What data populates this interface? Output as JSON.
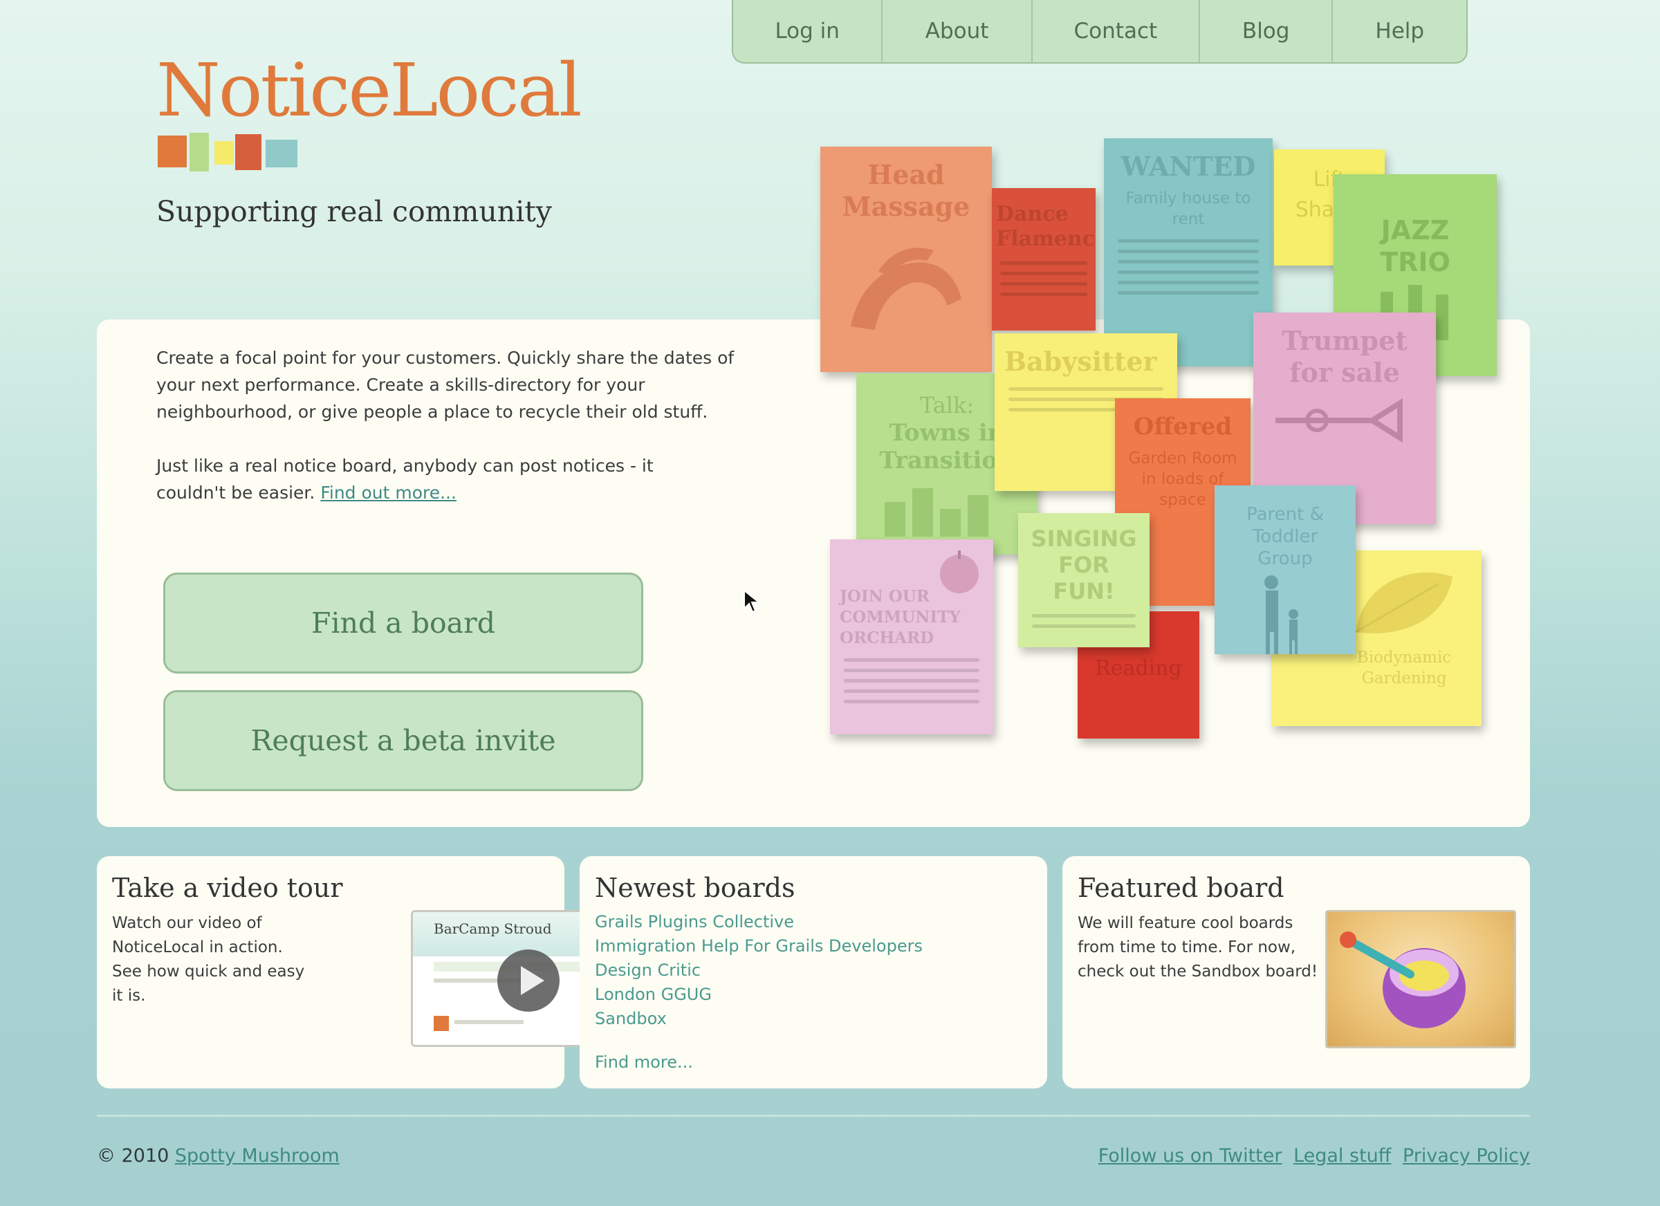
{
  "nav": {
    "items": [
      {
        "label": "Log in"
      },
      {
        "label": "About"
      },
      {
        "label": "Contact"
      },
      {
        "label": "Blog"
      },
      {
        "label": "Help"
      }
    ]
  },
  "brand": {
    "name": "NoticeLocal",
    "tagline": "Supporting real community",
    "colors": [
      "#e0793b",
      "#b6dc8a",
      "#f5ea6a",
      "#d65f3e",
      "#8fc9c8"
    ]
  },
  "hero": {
    "paragraph1": "Create a focal point for your customers. Quickly share the dates of your next performance. Create a skills-directory for your neighbourhood, or give people a place to recycle their old stuff.",
    "paragraph2": "Just like a real notice board, anybody can post notices - it couldn't be easier.",
    "find_out_more": "Find out more...",
    "find_board_button": "Find a board",
    "beta_invite_button": "Request a beta invite"
  },
  "notes": {
    "head_massage": {
      "line1": "Head",
      "line2": "Massage"
    },
    "dance": {
      "line1": "Dance",
      "line2": "Flamenco"
    },
    "wanted": {
      "title": "WANTED",
      "subtitle": "Family house to rent"
    },
    "lift_share": {
      "line1": "Lift",
      "line2": "Share!"
    },
    "jazz_trio": {
      "line1": "JAZZ",
      "line2": "TRIO"
    },
    "towns": {
      "line1": "Talk:",
      "line2": "Towns in",
      "line3": "Transition"
    },
    "babysitter": {
      "title": "Babysitter"
    },
    "offered": {
      "title": "Offered",
      "subtitle": "Garden Room in loads of space"
    },
    "trumpet": {
      "line1": "Trumpet",
      "line2": "for sale"
    },
    "parent_toddler": {
      "title": "Parent & Toddler Group"
    },
    "orchard": {
      "title": "JOIN OUR COMMUNITY ORCHARD"
    },
    "singing": {
      "line1": "SINGING",
      "line2": "FOR FUN!"
    },
    "reading": {
      "title": "Reading"
    },
    "gardening": {
      "title": "Biodynamic Gardening"
    }
  },
  "video_tour": {
    "title": "Take a video tour",
    "text": "Watch our video of NoticeLocal in action. See how quick and easy it is.",
    "thumb_title": "BarCamp Stroud"
  },
  "newest_boards": {
    "title": "Newest boards",
    "items": [
      "Grails Plugins Collective",
      "Immigration Help For Grails Developers",
      "Design Critic",
      "London GGUG",
      "Sandbox"
    ],
    "find_more": "Find more..."
  },
  "featured_board": {
    "title": "Featured board",
    "text": "We will feature cool boards from time to time. For now, check out the Sandbox board!"
  },
  "footer": {
    "copyright": "© 2010",
    "company": "Spotty Mushroom",
    "links": [
      "Follow us on Twitter",
      "Legal stuff",
      "Privacy Policy"
    ]
  }
}
